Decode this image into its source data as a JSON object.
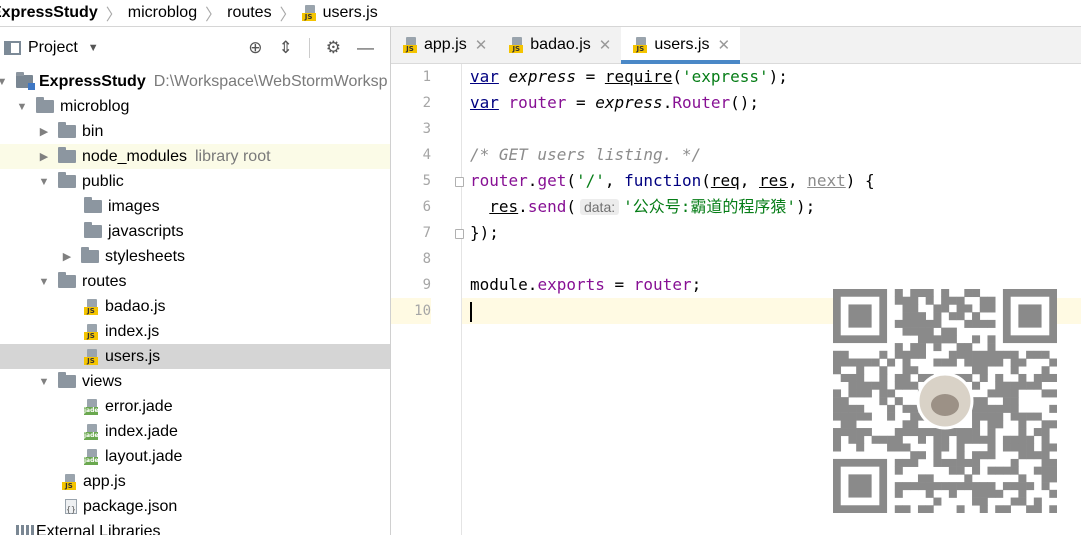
{
  "breadcrumb": {
    "items": [
      "ExpressStudy",
      "microblog",
      "routes",
      "users.js"
    ]
  },
  "project_panel": {
    "title": "Project",
    "tools": [
      "target-icon",
      "collapse-icon",
      "gear-icon",
      "minimize-icon"
    ],
    "tree": [
      {
        "label": "ExpressStudy",
        "note": "D:\\Workspace\\WebStormWorksp",
        "type": "module",
        "level": 0,
        "expanded": true
      },
      {
        "label": "microblog",
        "type": "folder",
        "level": 1,
        "expanded": true
      },
      {
        "label": "bin",
        "type": "folder",
        "level": 2,
        "expanded": false
      },
      {
        "label": "node_modules",
        "note": "library root",
        "type": "folder",
        "level": 2,
        "expanded": false
      },
      {
        "label": "public",
        "type": "folder",
        "level": 2,
        "expanded": true
      },
      {
        "label": "images",
        "type": "folder",
        "level": 3
      },
      {
        "label": "javascripts",
        "type": "folder",
        "level": 3
      },
      {
        "label": "stylesheets",
        "type": "folder",
        "level": 3,
        "expanded": false
      },
      {
        "label": "routes",
        "type": "folder",
        "level": 2,
        "expanded": true
      },
      {
        "label": "badao.js",
        "type": "js",
        "level": 3
      },
      {
        "label": "index.js",
        "type": "js",
        "level": 3
      },
      {
        "label": "users.js",
        "type": "js",
        "level": 3,
        "selected": true
      },
      {
        "label": "views",
        "type": "folder",
        "level": 2,
        "expanded": true
      },
      {
        "label": "error.jade",
        "type": "jade",
        "level": 3
      },
      {
        "label": "index.jade",
        "type": "jade",
        "level": 3
      },
      {
        "label": "layout.jade",
        "type": "jade",
        "level": 3
      },
      {
        "label": "app.js",
        "type": "js",
        "level": 2
      },
      {
        "label": "package.json",
        "type": "json",
        "level": 2
      },
      {
        "label": "External Libraries",
        "type": "lib",
        "level": 0
      }
    ]
  },
  "editor": {
    "tabs": [
      {
        "label": "app.js",
        "active": false
      },
      {
        "label": "badao.js",
        "active": false
      },
      {
        "label": "users.js",
        "active": true
      }
    ],
    "line_numbers": [
      "1",
      "2",
      "3",
      "4",
      "5",
      "6",
      "7",
      "8",
      "9",
      "10"
    ],
    "code": {
      "l1": {
        "kw": "var",
        "name": "express",
        "op": " = ",
        "fn": "require",
        "open": "(",
        "str": "'express'",
        "close": ");"
      },
      "l2": {
        "kw": "var",
        "name": "router",
        "op": " = ",
        "obj": "express",
        "dot": ".",
        "fn": "Router",
        "close": "();"
      },
      "l4": {
        "comment": "/* GET users listing. */"
      },
      "l5": {
        "obj": "router",
        "dot": ".",
        "method": "get",
        "open": "(",
        "str": "'/'",
        "sep": ", ",
        "kw": "function",
        "p_open": "(",
        "p1": "req",
        "c1": ", ",
        "p2": "res",
        "c2": ", ",
        "p3": "next",
        "tail": ") {"
      },
      "l6": {
        "indent": "  ",
        "obj": "res",
        "dot": ".",
        "method": "send",
        "open": "(",
        "hint": "data:",
        "str": "'公众号:霸道的程序猿'",
        "close": ");"
      },
      "l7": {
        "text": "});"
      },
      "l9": {
        "obj": "module",
        "dot": ".",
        "mem": "exports",
        "op": " = ",
        "val": "router",
        "end": ";"
      }
    },
    "current_line": 10
  },
  "colors": {
    "keyword": "#000080",
    "string": "#067d17",
    "comment": "#8c8c8c",
    "member": "#871094",
    "tab_underline": "#4a88c7",
    "selection": "#d5d5d5",
    "library_row": "#fbfbe7"
  }
}
